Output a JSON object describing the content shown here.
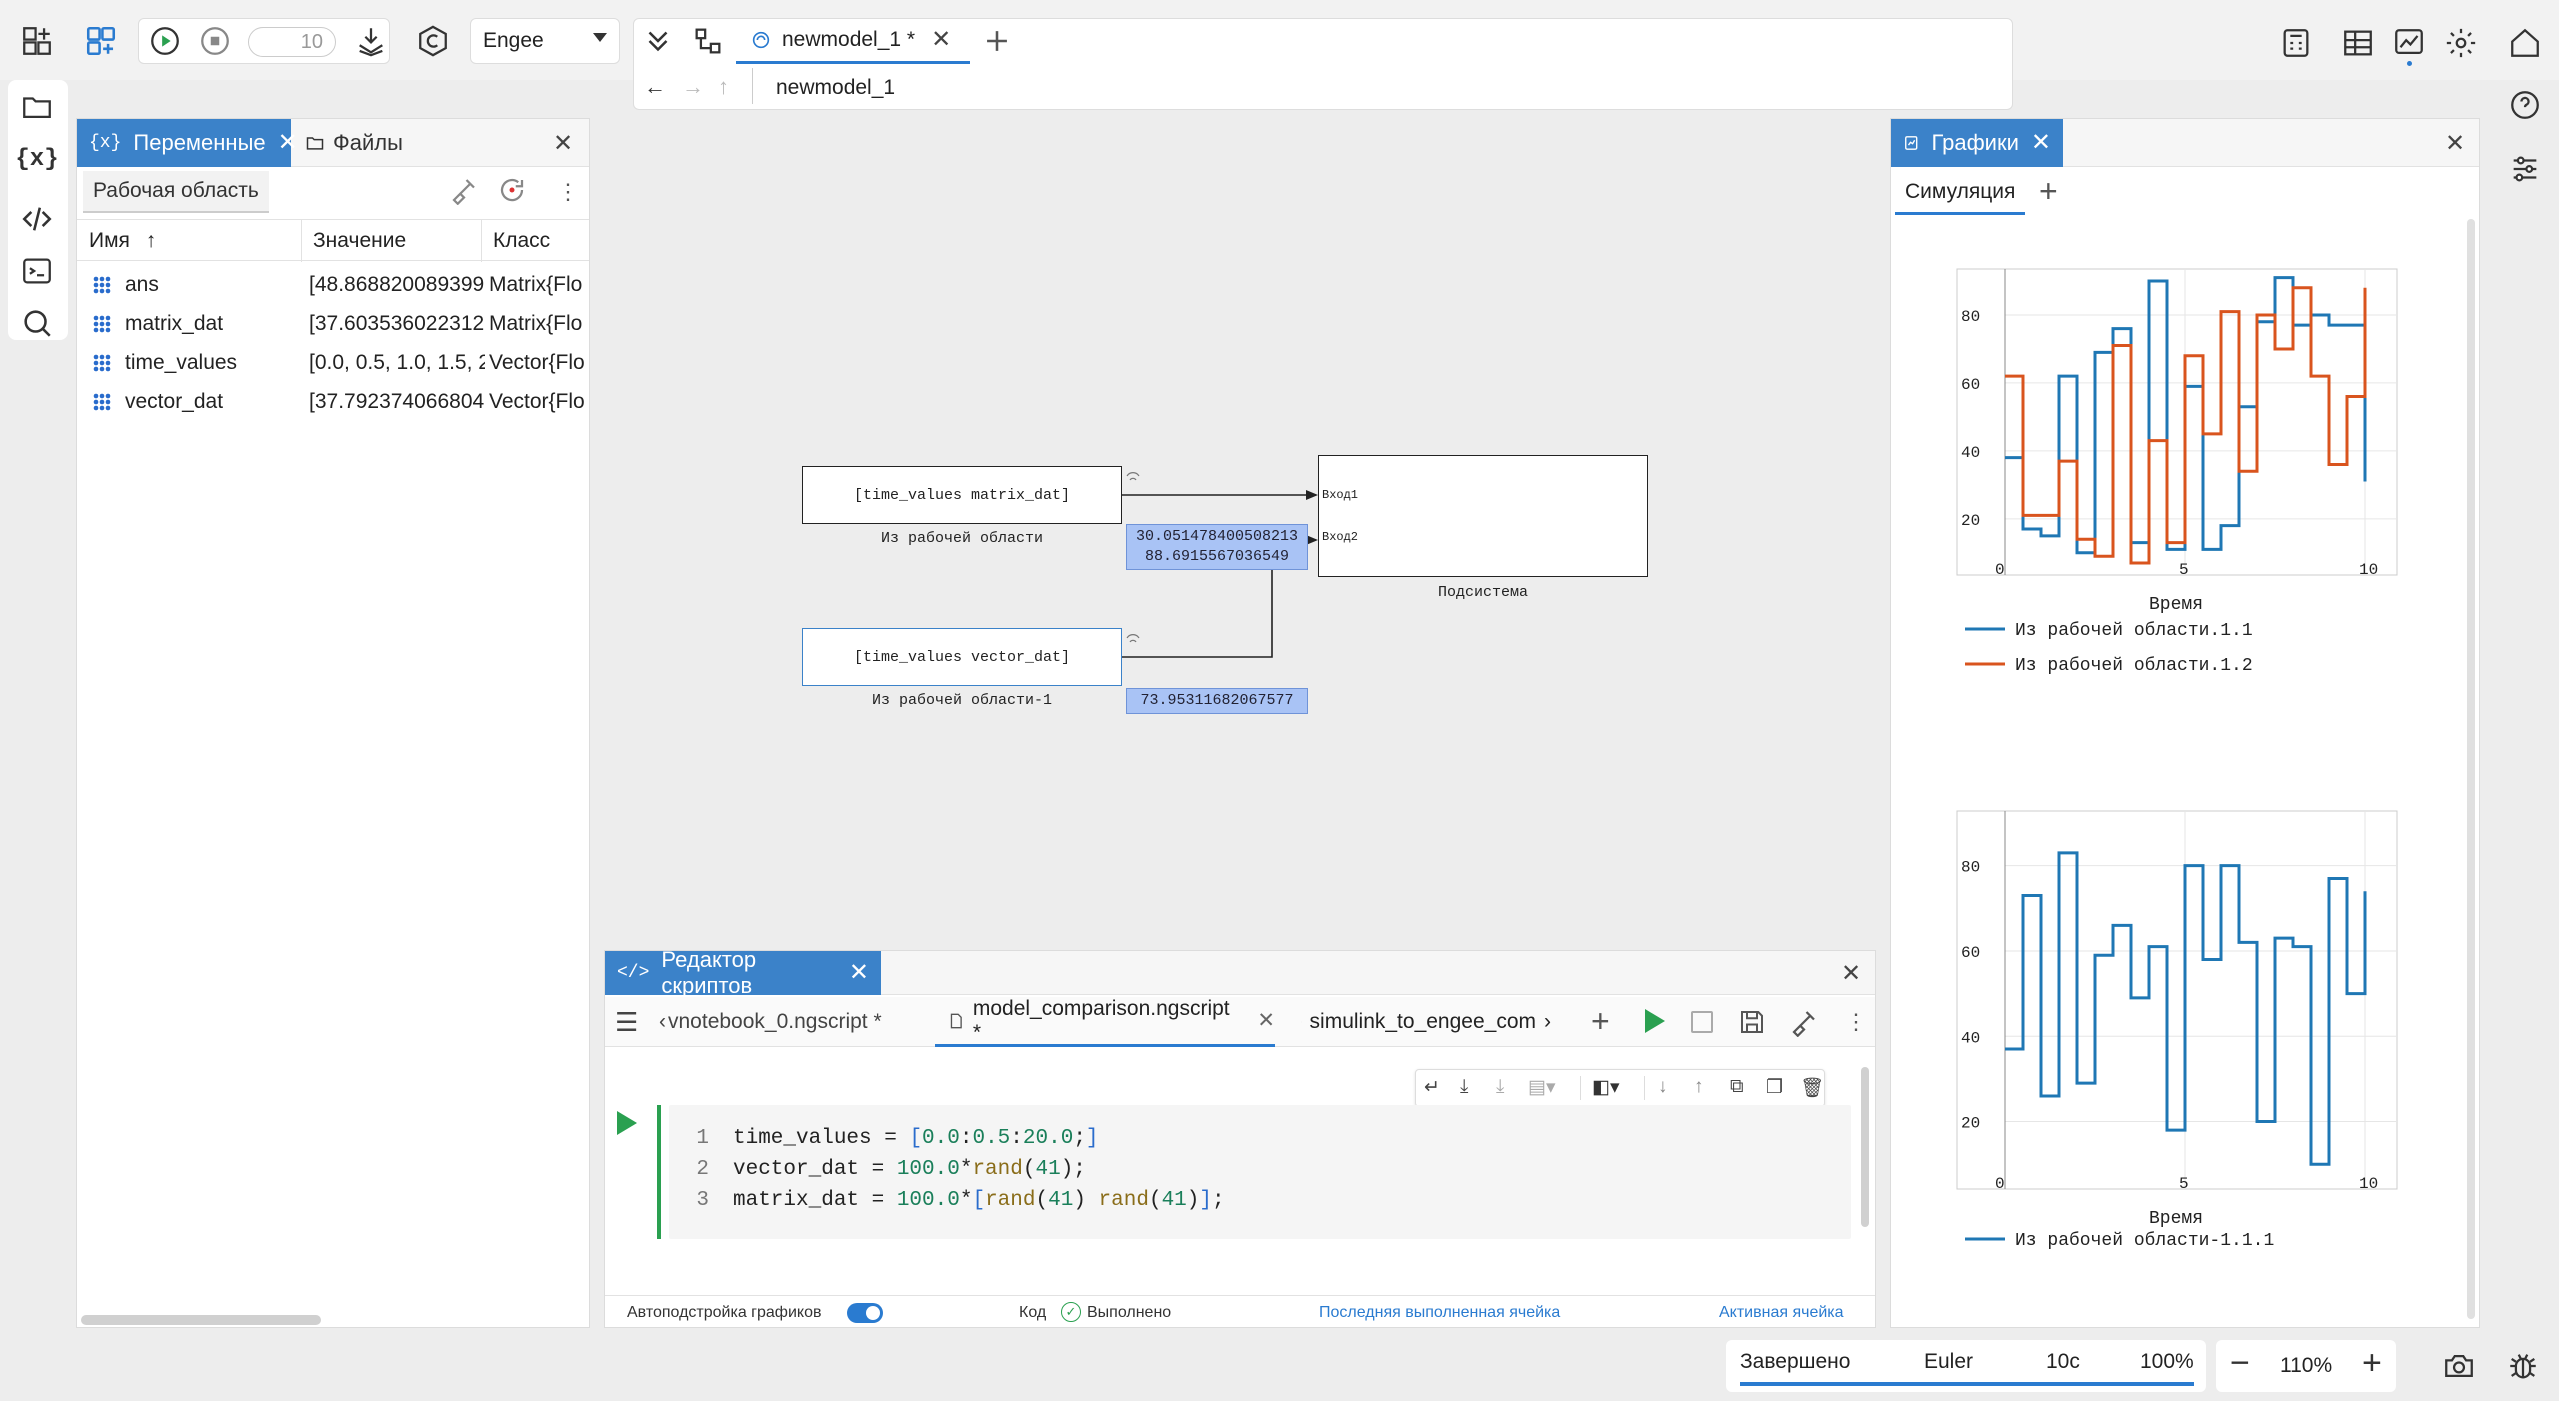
{
  "toolbar": {
    "steps_value": "10",
    "solver_select": "Engee",
    "model_tab": "newmodel_1 *",
    "breadcrumb": "newmodel_1"
  },
  "variables_panel": {
    "tab_variables": "Переменные",
    "tab_files": "Файлы",
    "workspace_label": "Рабочая область",
    "columns": [
      "Имя",
      "Значение",
      "Класс"
    ],
    "sort_arrow": "↑",
    "rows": [
      {
        "name": "ans",
        "value": "[48.868820089399",
        "class": "Matrix{Flo"
      },
      {
        "name": "matrix_dat",
        "value": "[37.603536022312",
        "class": "Matrix{Flo"
      },
      {
        "name": "time_values",
        "value": "[0.0, 0.5, 1.0, 1.5, 2.0",
        "class": "Vector{Flo"
      },
      {
        "name": "vector_dat",
        "value": "[37.792374066804",
        "class": "Vector{Flo"
      }
    ]
  },
  "diagram": {
    "block1_text": "[time_values matrix_dat]",
    "block1_caption": "Из рабочей области",
    "block2_text": "[time_values vector_dat]",
    "block2_caption": "Из рабочей области-1",
    "subsystem_caption": "Подсистема",
    "port1": "Вход1",
    "port2": "Вход2",
    "probe1_line1": "30.051478400508213",
    "probe1_line2": "88.6915567036549",
    "probe2": "73.95311682067577"
  },
  "script_editor": {
    "title": "Редактор скриптов",
    "tabs": [
      {
        "label": "vnotebook_0.ngscript *"
      },
      {
        "label": "model_comparison.ngscript *"
      },
      {
        "label": "simulink_to_engee_com"
      }
    ],
    "line_numbers": [
      "1",
      "2",
      "3"
    ],
    "code": [
      "time_values = [0.0:0.5:20.0;]",
      "vector_dat = 100.0*rand(41);",
      "matrix_dat = 100.0*[rand(41) rand(41)];"
    ],
    "status_autoplot": "Автоподстройка графиков",
    "status_code": "Код",
    "status_done": "Выполнено",
    "status_last_cell": "Последняя выполненная ячейка",
    "status_active_cell": "Активная ячейка"
  },
  "plots_panel": {
    "title": "Графики",
    "tab": "Симуляция",
    "colors": {
      "blue": "#1f77b4",
      "orange": "#d9541e"
    }
  },
  "chart_data": [
    {
      "type": "line",
      "xlabel": "Время",
      "xlim": [
        0,
        10
      ],
      "ylim": [
        7,
        90
      ],
      "xticks": [
        "0",
        "5",
        "10"
      ],
      "yticks": [
        "20",
        "40",
        "60",
        "80"
      ],
      "step": true,
      "legend": [
        "Из рабочей области.1.1",
        "Из рабочей области.1.2"
      ],
      "series": [
        {
          "name": "Из рабочей области.1.1",
          "color": "#1f77b4",
          "x": [
            0,
            0.5,
            1,
            1.5,
            2,
            2.5,
            3,
            3.5,
            4,
            4.5,
            5,
            5.5,
            6,
            6.5,
            7,
            7.5,
            8,
            8.5,
            9,
            9.5,
            10
          ],
          "y": [
            38,
            17,
            15,
            62,
            10,
            69,
            76,
            13,
            90,
            11,
            59,
            11,
            18,
            53,
            78,
            91,
            77,
            80,
            77,
            77,
            31
          ]
        },
        {
          "name": "Из рабочей области.1.2",
          "color": "#d9541e",
          "x": [
            0,
            0.5,
            1,
            1.5,
            2,
            2.5,
            3,
            3.5,
            4,
            4.5,
            5,
            5.5,
            6,
            6.5,
            7,
            7.5,
            8,
            8.5,
            9,
            9.5,
            10
          ],
          "y": [
            62,
            21,
            21,
            37,
            14,
            9,
            71,
            7,
            43,
            13,
            68,
            45,
            81,
            34,
            80,
            70,
            88,
            62,
            36,
            56,
            88
          ]
        }
      ]
    },
    {
      "type": "line",
      "xlabel": "Время",
      "xlim": [
        0,
        10
      ],
      "ylim": [
        7,
        90
      ],
      "xticks": [
        "0",
        "5",
        "10"
      ],
      "yticks": [
        "20",
        "40",
        "60",
        "80"
      ],
      "step": true,
      "legend": [
        "Из рабочей области-1.1.1"
      ],
      "series": [
        {
          "name": "Из рабочей области-1.1.1",
          "color": "#1f77b4",
          "x": [
            0,
            0.5,
            1,
            1.5,
            2,
            2.5,
            3,
            3.5,
            4,
            4.5,
            5,
            5.5,
            6,
            6.5,
            7,
            7.5,
            8,
            8.5,
            9,
            9.5,
            10
          ],
          "y": [
            37,
            73,
            26,
            83,
            29,
            59,
            66,
            49,
            61,
            18,
            80,
            58,
            80,
            62,
            20,
            63,
            61,
            10,
            77,
            50,
            74
          ]
        }
      ]
    }
  ],
  "status_bar": {
    "state": "Завершено",
    "solver": "Euler",
    "time": "10с",
    "progress_label": "100%",
    "progress": 1.0,
    "zoom": "110%"
  }
}
